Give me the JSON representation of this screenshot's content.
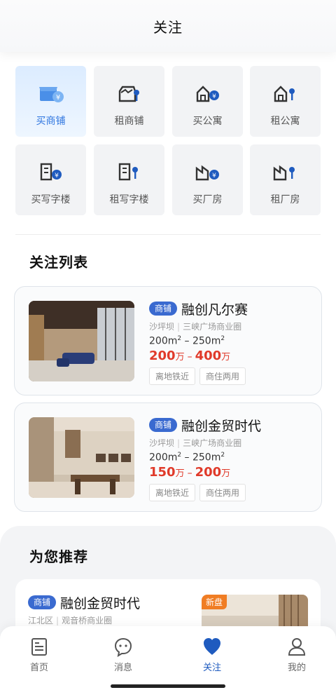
{
  "header": {
    "title": "关注"
  },
  "categories": [
    {
      "label": "买商铺",
      "icon": "shop-buy-icon",
      "active": true
    },
    {
      "label": "租商铺",
      "icon": "shop-rent-icon"
    },
    {
      "label": "买公寓",
      "icon": "apartment-buy-icon"
    },
    {
      "label": "租公寓",
      "icon": "apartment-rent-icon"
    },
    {
      "label": "买写字楼",
      "icon": "office-buy-icon"
    },
    {
      "label": "租写字楼",
      "icon": "office-rent-icon"
    },
    {
      "label": "买厂房",
      "icon": "factory-buy-icon"
    },
    {
      "label": "租厂房",
      "icon": "factory-rent-icon"
    }
  ],
  "favorites": {
    "title": "关注列表",
    "items": [
      {
        "tag": "商铺",
        "name": "融创凡尔赛",
        "district": "沙坪坝",
        "area_name": "三峡广场商业圈",
        "area_prefix": "200m",
        "area_sup1": "2",
        "area_mid": " – 250m",
        "area_sup2": "2",
        "price_min": "200",
        "price_max": "400",
        "price_unit": "万",
        "price_dash": "–",
        "badges": [
          "离地铁近",
          "商住两用"
        ]
      },
      {
        "tag": "商铺",
        "name": "融创金贸时代",
        "district": "沙坪坝",
        "area_name": "三峡广场商业圈",
        "area_prefix": "200m",
        "area_sup1": "2",
        "area_mid": " – 250m",
        "area_sup2": "2",
        "price_min": "150",
        "price_max": "200",
        "price_unit": "万",
        "price_dash": "–",
        "badges": [
          "离地铁近",
          "商住两用"
        ]
      }
    ]
  },
  "recommend": {
    "title": "为您推荐",
    "item": {
      "tag": "商铺",
      "name": "融创金贸时代",
      "district": "江北区",
      "area_name": "观音桥商业圈",
      "new_label": "新盘"
    }
  },
  "tabbar": [
    {
      "label": "首页",
      "icon": "home-icon"
    },
    {
      "label": "消息",
      "icon": "message-icon"
    },
    {
      "label": "关注",
      "icon": "heart-icon",
      "active": true
    },
    {
      "label": "我的",
      "icon": "user-icon"
    }
  ],
  "colors": {
    "accent": "#1f5bbf",
    "price": "#e03a2a",
    "tag": "#3a6ad0"
  }
}
